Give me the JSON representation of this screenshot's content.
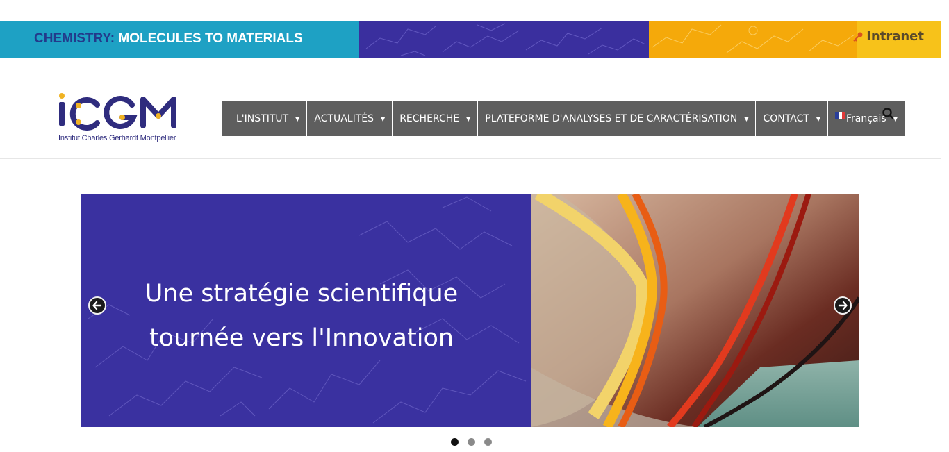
{
  "banner": {
    "tagline_prefix": "CHEMISTRY:",
    "tagline_rest": " MOLECULES TO MATERIALS",
    "intranet_label": "Intranet",
    "colors": {
      "teal": "#1ea1c4",
      "indigo": "#3a2f9e",
      "orange": "#f5a90a",
      "yellow": "#f7c21a"
    }
  },
  "logo": {
    "letters": "iCGM",
    "subtitle": "Institut Charles Gerhardt Montpellier",
    "brand_color": "#2f2c7e",
    "accent_color": "#f0b323"
  },
  "nav": {
    "items": [
      {
        "label": "L'INSTITUT"
      },
      {
        "label": "ACTUALITÉS"
      },
      {
        "label": "RECHERCHE"
      },
      {
        "label": "PLATEFORME D'ANALYSES ET DE CARACTÉRISATION"
      },
      {
        "label": "CONTACT"
      }
    ],
    "language": "Français",
    "caret": "▼",
    "bg_color": "#5e5e5e"
  },
  "search": {
    "icon": "search-icon"
  },
  "slider": {
    "title_line1": "Une stratégie scientifique",
    "title_line2": "tournée vers l'Innovation",
    "slide_count": 3,
    "active_index": 0,
    "prev_icon": "arrow-left-icon",
    "next_icon": "arrow-right-icon"
  }
}
